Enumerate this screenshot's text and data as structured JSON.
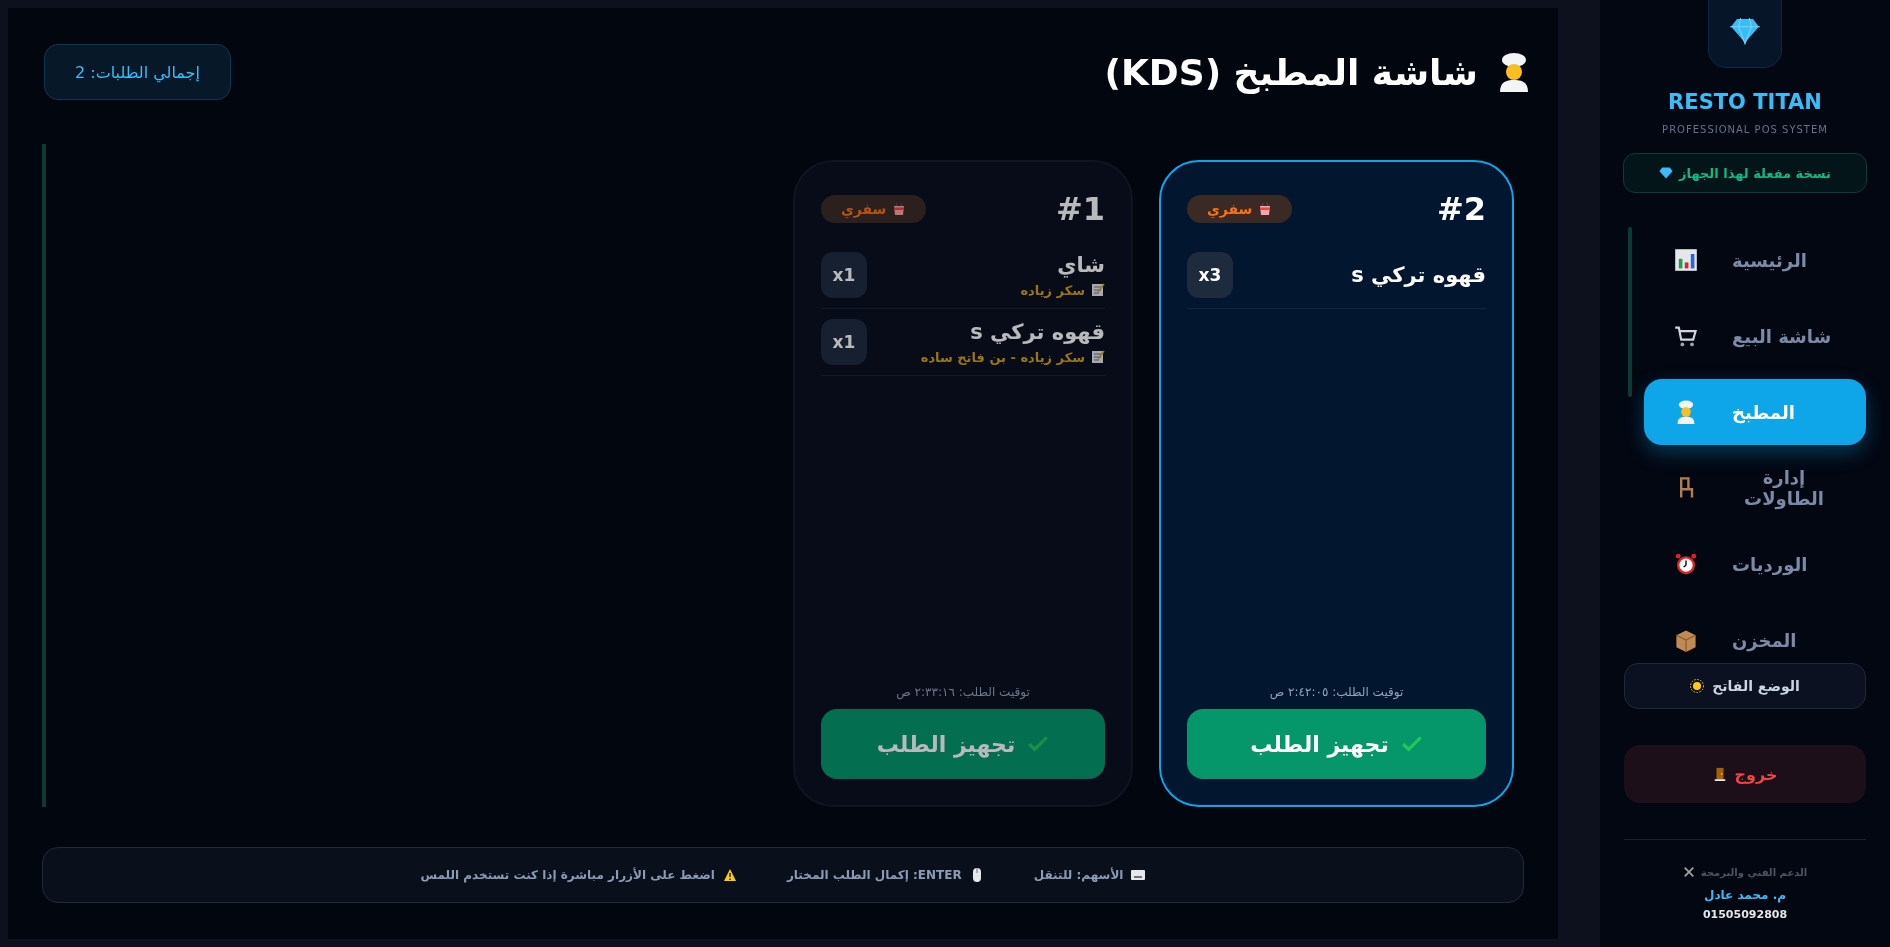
{
  "header": {
    "title": "شاشة المطبخ (KDS)",
    "total": "إجمالي الطلبات: 2"
  },
  "orders": [
    {
      "number": "#2",
      "selected": true,
      "type": "سفري",
      "items": [
        {
          "name": "قهوه تركي s",
          "qty": "x3"
        }
      ],
      "time": "توقيت الطلب: ٢:٤٢:٠٥ ص",
      "button": "تجهيز الطلب"
    },
    {
      "number": "#1",
      "selected": false,
      "type": "سفري",
      "items": [
        {
          "name": "شاي",
          "qty": "x1",
          "note": "سكر زياده"
        },
        {
          "name": "قهوه تركي s",
          "qty": "x1",
          "note": "سكر زياده - بن فاتح ساده"
        }
      ],
      "time": "توقيت الطلب: ٢:٣٣:١٦ ص",
      "button": "تجهيز الطلب"
    }
  ],
  "hints": [
    "الأسهم: للتنقل",
    "ENTER: إكمال الطلب المختار",
    "اضغط على الأزرار مباشرة إذا كنت تستخدم اللمس"
  ],
  "sidebar": {
    "brand": "RESTO TITAN",
    "subtitle": "PROFESSIONAL POS SYSTEM",
    "license": "نسخة مفعلة لهذا الجهاز",
    "items": [
      {
        "label": "الرئيسية",
        "selected": false
      },
      {
        "label": "شاشة البيع",
        "selected": false
      },
      {
        "label": "المطبخ",
        "selected": true
      },
      {
        "label": "إدارة الطاولات",
        "selected": false
      },
      {
        "label": "الورديات",
        "selected": false
      },
      {
        "label": "المخزن",
        "selected": false
      }
    ],
    "theme_button": "الوضع الفاتح",
    "logout": "خروج",
    "support_label": "الدعم الفني والبرمجة",
    "developer": "م. محمد عادل",
    "phone": "01505092808"
  }
}
